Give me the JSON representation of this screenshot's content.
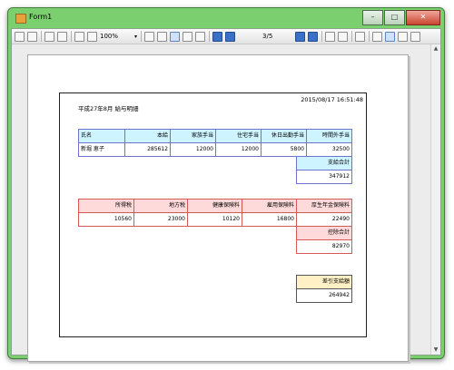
{
  "window": {
    "title": "Form1",
    "minimize": "–",
    "maximize": "□",
    "close": "✕"
  },
  "toolbar": {
    "zoom": "100%",
    "zoom_drop": "▾",
    "page": "3/5"
  },
  "scroll": {
    "up": "▲",
    "down": "▼"
  },
  "report": {
    "date": "2015/08/17 16:51:48",
    "title": "平成27年8月 給与明細",
    "pay": {
      "headers": [
        "氏名",
        "本給",
        "家族手当",
        "住宅手当",
        "休日出勤手当",
        "時間外手当"
      ],
      "values": [
        "新堀 恵子",
        "285612",
        "12000",
        "12000",
        "5800",
        "32500"
      ],
      "total_label": "支給合計",
      "total": "347912"
    },
    "deduction": {
      "headers": [
        "所得税",
        "地方税",
        "健康保険料",
        "雇用保険料",
        "厚生年金保険料"
      ],
      "values": [
        "10560",
        "23000",
        "10120",
        "16800",
        "22490"
      ],
      "total_label": "控除合計",
      "total": "82970"
    },
    "net": {
      "label": "差引支給額",
      "value": "264942"
    }
  }
}
